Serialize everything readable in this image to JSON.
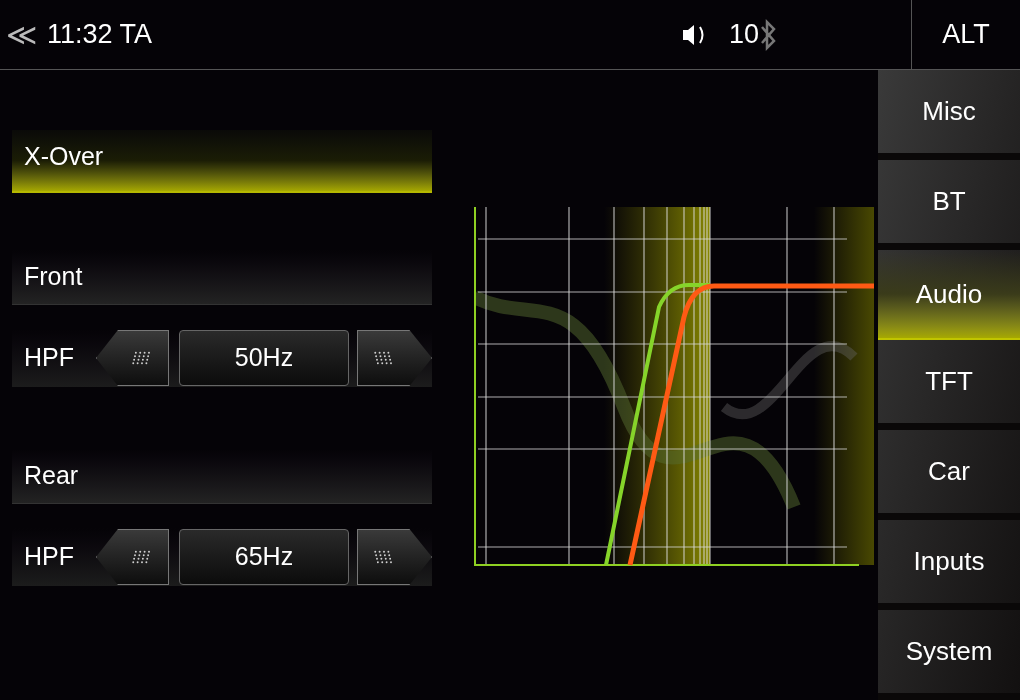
{
  "status_bar": {
    "back": "≪",
    "time": "11:32 TA",
    "volume": "10",
    "alt_button": "ALT"
  },
  "section_header": "X-Over",
  "channels": [
    {
      "name": "Front",
      "filter": "HPF",
      "value": "50Hz"
    },
    {
      "name": "Rear",
      "filter": "HPF",
      "value": "65Hz"
    }
  ],
  "nav": [
    {
      "label": "Misc",
      "selected": false
    },
    {
      "label": "BT",
      "selected": false
    },
    {
      "label": "Audio",
      "selected": true
    },
    {
      "label": "TFT",
      "selected": false
    },
    {
      "label": "Car",
      "selected": false
    },
    {
      "label": "Inputs",
      "selected": false
    },
    {
      "label": "System",
      "selected": false
    }
  ]
}
